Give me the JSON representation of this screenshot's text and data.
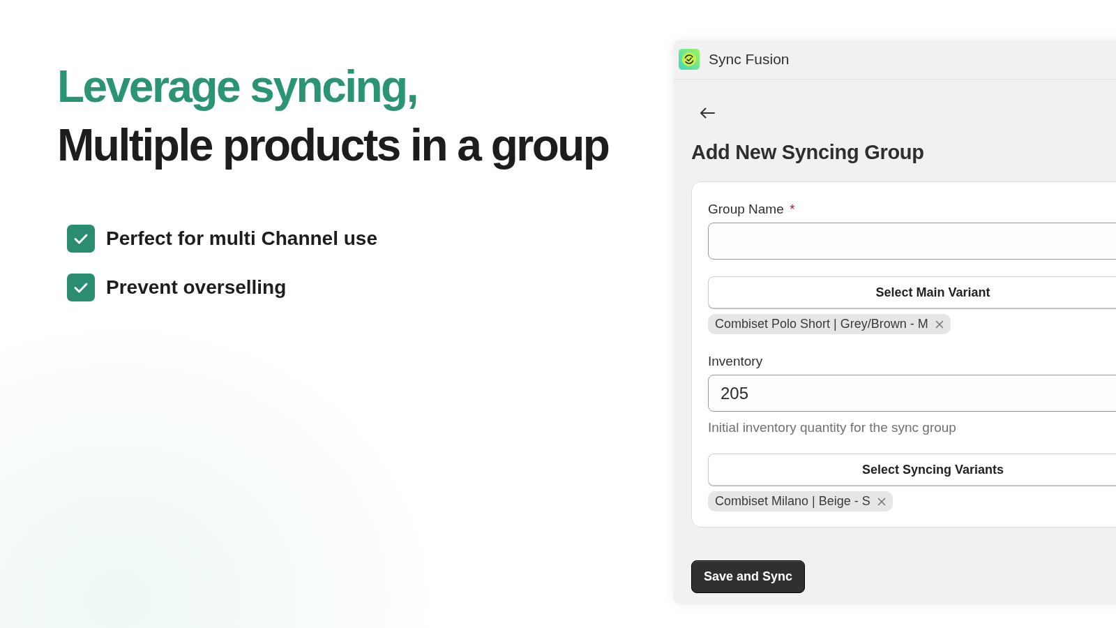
{
  "headline": {
    "accent": "Leverage syncing,",
    "main": "Multiple products in a group"
  },
  "features": [
    "Perfect for multi Channel use",
    "Prevent overselling"
  ],
  "app": {
    "title": "Sync Fusion",
    "heading": "Add New Syncing Group",
    "group_name": {
      "label": "Group Name",
      "required_mark": "*"
    },
    "main_variant": {
      "button": "Select Main Variant",
      "chips": [
        "Combiset Polo Short | Grey/Brown - M"
      ]
    },
    "inventory": {
      "label": "Inventory",
      "value": "205",
      "hint": "Initial inventory quantity for the sync group"
    },
    "syncing_variants": {
      "button": "Select Syncing Variants",
      "chips": [
        "Combiset Milano | Beige - S"
      ]
    },
    "save_button": "Save and Sync"
  }
}
